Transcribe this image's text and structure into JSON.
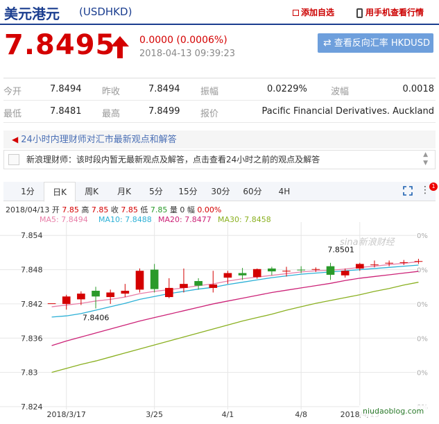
{
  "header": {
    "name": "美元港元",
    "code": "(USDHKD)",
    "add_watch": "添加自选",
    "mobile_view": "用手机查看行情"
  },
  "quote": {
    "price": "7.8495",
    "change": "0.0000 (0.0006%)",
    "time": "2018-04-13 09:39:23",
    "reverse_button": "查看反向汇率 HKDUSD"
  },
  "stats": [
    [
      {
        "label": "今开",
        "value": "7.8494"
      },
      {
        "label": "昨收",
        "value": "7.8494"
      },
      {
        "label": "振幅",
        "value": "0.0229%"
      },
      {
        "label": "波幅",
        "value": "0.0018"
      }
    ],
    [
      {
        "label": "最低",
        "value": "7.8481"
      },
      {
        "label": "最高",
        "value": "7.8499"
      },
      {
        "label": "报价",
        "value": "Pacific Financial Derivatives. Auckland"
      }
    ]
  ],
  "qa": {
    "title": "24小时内理财师对汇市最新观点和解答",
    "line": "新浪理财师：该时段内暂无最新观点及解答，点击查看24小时之前的观点及解答"
  },
  "tabs": [
    "1分",
    "日K",
    "周K",
    "月K",
    "5分",
    "15分",
    "30分",
    "60分",
    "4H"
  ],
  "active_tab": 1,
  "badge": "1",
  "ohlc": {
    "date": "2018/04/13",
    "open_label": "开",
    "open": "7.85",
    "high_label": "高",
    "high": "7.85",
    "close_label": "收",
    "close": "7.85",
    "low_label": "低",
    "low": "7.85",
    "vol_label": "量",
    "vol": "0",
    "amp_label": "幅",
    "amp": "0.00%"
  },
  "ma_legend": [
    {
      "text": "MA5: 7.8494",
      "color": "#e87ea8"
    },
    {
      "text": "MA10: 7.8488",
      "color": "#2bb0d6"
    },
    {
      "text": "MA20: 7.8477",
      "color": "#cc2277"
    },
    {
      "text": "MA30: 7.8458",
      "color": "#8ab020"
    }
  ],
  "colors": {
    "up": "#d40000",
    "down": "#2a9a2a",
    "brand": "#1a3d8f"
  },
  "watermark": "niudaoblog.com",
  "chart_data": {
    "type": "candlestick",
    "ylim": [
      7.824,
      7.855
    ],
    "yticks": [
      "7.854",
      "7.848",
      "7.842",
      "7.836",
      "7.83",
      "7.824"
    ],
    "right_labels": [
      "0%",
      "0%",
      "0%",
      "0%",
      "0%",
      "0%"
    ],
    "xticks": [
      {
        "label": "2018/3/17",
        "index": 1
      },
      {
        "label": "3/25",
        "index": 7
      },
      {
        "label": "4/1",
        "index": 12
      },
      {
        "label": "4/8",
        "index": 17
      },
      {
        "label": "2018/4/13",
        "index": 21
      }
    ],
    "annotations": [
      {
        "text": "7.8406",
        "index": 2,
        "value": 7.8406
      },
      {
        "text": "7.8501",
        "index": 20,
        "value": 7.8501
      }
    ],
    "watermark_text": "sina新浪财经",
    "candles": [
      {
        "o": 7.8421,
        "h": 7.8421,
        "l": 7.8421,
        "c": 7.8421
      },
      {
        "o": 7.842,
        "h": 7.8436,
        "l": 7.841,
        "c": 7.8433
      },
      {
        "o": 7.8428,
        "h": 7.8442,
        "l": 7.8418,
        "c": 7.8438
      },
      {
        "o": 7.8443,
        "h": 7.845,
        "l": 7.8412,
        "c": 7.8433
      },
      {
        "o": 7.8432,
        "h": 7.8445,
        "l": 7.842,
        "c": 7.844
      },
      {
        "o": 7.8438,
        "h": 7.8455,
        "l": 7.8432,
        "c": 7.8443
      },
      {
        "o": 7.8445,
        "h": 7.8482,
        "l": 7.844,
        "c": 7.8478
      },
      {
        "o": 7.848,
        "h": 7.849,
        "l": 7.844,
        "c": 7.8446
      },
      {
        "o": 7.8432,
        "h": 7.8465,
        "l": 7.843,
        "c": 7.8448
      },
      {
        "o": 7.8448,
        "h": 7.8482,
        "l": 7.844,
        "c": 7.8455
      },
      {
        "o": 7.846,
        "h": 7.8465,
        "l": 7.8445,
        "c": 7.8452
      },
      {
        "o": 7.8448,
        "h": 7.8478,
        "l": 7.844,
        "c": 7.8454
      },
      {
        "o": 7.8466,
        "h": 7.8478,
        "l": 7.8455,
        "c": 7.8474
      },
      {
        "o": 7.8474,
        "h": 7.8483,
        "l": 7.8462,
        "c": 7.847
      },
      {
        "o": 7.8467,
        "h": 7.8482,
        "l": 7.8464,
        "c": 7.8481
      },
      {
        "o": 7.8482,
        "h": 7.8485,
        "l": 7.847,
        "c": 7.8477
      },
      {
        "o": 7.8478,
        "h": 7.8485,
        "l": 7.8468,
        "c": 7.8478
      },
      {
        "o": 7.848,
        "h": 7.8486,
        "l": 7.8474,
        "c": 7.8479
      },
      {
        "o": 7.848,
        "h": 7.8484,
        "l": 7.8476,
        "c": 7.8481
      },
      {
        "o": 7.8486,
        "h": 7.8492,
        "l": 7.8462,
        "c": 7.8471
      },
      {
        "o": 7.847,
        "h": 7.8482,
        "l": 7.8466,
        "c": 7.8478
      },
      {
        "o": 7.8482,
        "h": 7.8492,
        "l": 7.8478,
        "c": 7.849
      },
      {
        "o": 7.8489,
        "h": 7.8496,
        "l": 7.8484,
        "c": 7.8489
      },
      {
        "o": 7.8491,
        "h": 7.8496,
        "l": 7.8486,
        "c": 7.8492
      },
      {
        "o": 7.8493,
        "h": 7.8497,
        "l": 7.8488,
        "c": 7.8493
      },
      {
        "o": 7.8495,
        "h": 7.8499,
        "l": 7.849,
        "c": 7.8495
      }
    ],
    "series": [
      {
        "key": "MA5",
        "color": "#e87ea8",
        "values": [
          7.8415,
          7.8418,
          7.8421,
          7.8425,
          7.8428,
          7.8432,
          7.8438,
          7.8442,
          7.8445,
          7.8448,
          7.8452,
          7.8455,
          7.846,
          7.8464,
          7.8467,
          7.847,
          7.8473,
          7.8476,
          7.8478,
          7.8479,
          7.8481,
          7.8484,
          7.8486,
          7.8489,
          7.8491,
          7.8494
        ]
      },
      {
        "key": "MA10",
        "color": "#2bb0d6",
        "values": [
          7.8397,
          7.8399,
          7.8403,
          7.8409,
          7.8415,
          7.8421,
          7.8428,
          7.8433,
          7.8438,
          7.8442,
          7.8446,
          7.8449,
          7.8454,
          7.8458,
          7.8462,
          7.8466,
          7.8469,
          7.8472,
          7.8474,
          7.8476,
          7.8478,
          7.848,
          7.8482,
          7.8484,
          7.8486,
          7.8488
        ]
      },
      {
        "key": "MA20",
        "color": "#cc2277",
        "values": [
          7.8347,
          7.8355,
          7.8362,
          7.8369,
          7.8376,
          7.8383,
          7.839,
          7.8396,
          7.8402,
          7.8408,
          7.8414,
          7.842,
          7.8425,
          7.843,
          7.8435,
          7.844,
          7.8444,
          7.8448,
          7.8452,
          7.8456,
          7.8461,
          7.8465,
          7.8468,
          7.8471,
          7.8474,
          7.8477
        ]
      },
      {
        "key": "MA30",
        "color": "#8ab020",
        "values": [
          7.83,
          7.8307,
          7.8314,
          7.832,
          7.8327,
          7.8334,
          7.8341,
          7.8348,
          7.8355,
          7.8362,
          7.8369,
          7.8376,
          7.8383,
          7.839,
          7.8396,
          7.8402,
          7.8409,
          7.8415,
          7.8421,
          7.8426,
          7.8431,
          7.8436,
          7.8442,
          7.8447,
          7.8453,
          7.8458
        ]
      }
    ]
  }
}
